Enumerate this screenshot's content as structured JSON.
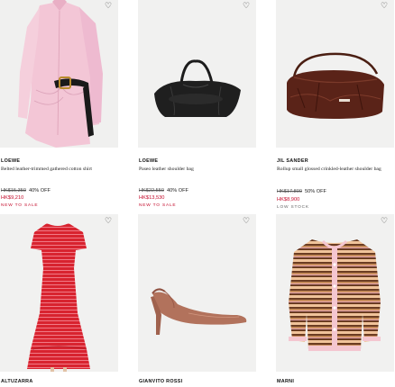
{
  "wishlist_icon": "heart-outline",
  "products": [
    {
      "brand": "LOEWE",
      "name": "Belted leather-trimmed gathered cotton shirt",
      "old_price": "HK$15,350",
      "discount": "40% OFF",
      "price": "HK$9,210",
      "tag": "NEW TO SALE"
    },
    {
      "brand": "LOEWE",
      "name": "Paseo leather shoulder bag",
      "old_price": "HK$22,550",
      "discount": "40% OFF",
      "price": "HK$13,530",
      "tag": "NEW TO SALE"
    },
    {
      "brand": "JIL SANDER",
      "name": "Rollup small glossed crinkled-leather shoulder bag",
      "old_price": "HK$17,800",
      "discount": "50% OFF",
      "price": "HK$8,900",
      "tag": "LOW STOCK"
    },
    {
      "brand": "ALTUZARRA"
    },
    {
      "brand": "GIANVITO ROSSI"
    },
    {
      "brand": "MARNI"
    }
  ]
}
